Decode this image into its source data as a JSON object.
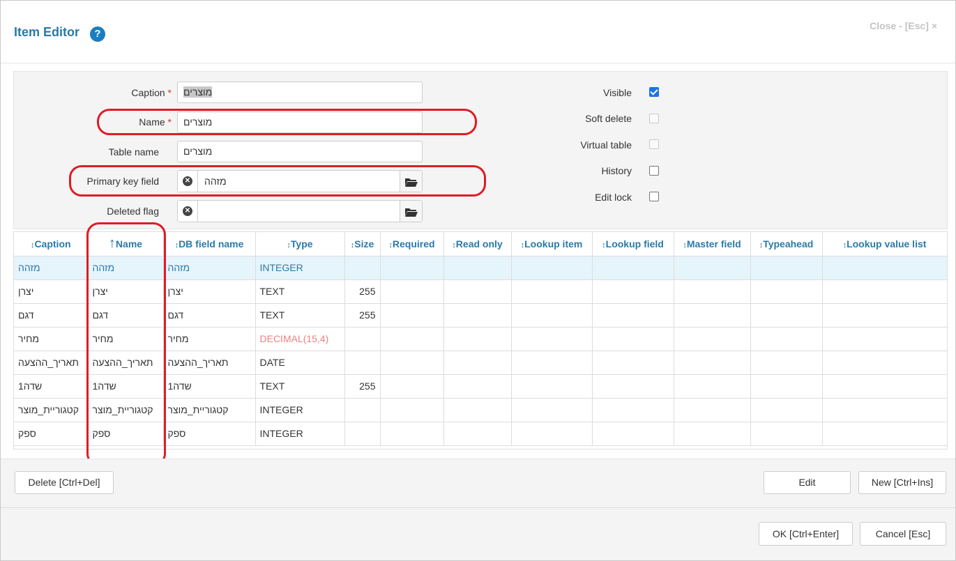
{
  "header": {
    "title": "Item Editor",
    "help_label": "?",
    "close_label": "Close - [Esc] ×"
  },
  "form": {
    "caption_label": "Caption",
    "caption_value": "מוצרים",
    "name_label": "Name",
    "name_value": "מוצרים",
    "table_name_label": "Table name",
    "table_name_value": "מוצרים",
    "primary_key_label": "Primary key field",
    "primary_key_value": "מזהה",
    "deleted_flag_label": "Deleted flag",
    "deleted_flag_value": "",
    "required_mark": "*",
    "visible_label": "Visible",
    "visible_checked": true,
    "soft_delete_label": "Soft delete",
    "soft_delete_checked": false,
    "virtual_table_label": "Virtual table",
    "virtual_table_checked": false,
    "history_label": "History",
    "history_checked": false,
    "edit_lock_label": "Edit lock",
    "edit_lock_checked": false
  },
  "table": {
    "columns": [
      "Caption",
      "Name",
      "DB field name",
      "Type",
      "Size",
      "Required",
      "Read only",
      "Lookup item",
      "Lookup field",
      "Master field",
      "Typeahead",
      "Lookup value list"
    ],
    "sort_icon": "↕",
    "active_sort_icon": "↑",
    "rows": [
      {
        "caption": "מזהה",
        "name": "מזהה",
        "db": "מזהה",
        "type": "INTEGER",
        "size": ""
      },
      {
        "caption": "יצרן",
        "name": "יצרן",
        "db": "יצרן",
        "type": "TEXT",
        "size": "255"
      },
      {
        "caption": "דגם",
        "name": "דגם",
        "db": "דגם",
        "type": "TEXT",
        "size": "255"
      },
      {
        "caption": "מחיר",
        "name": "מחיר",
        "db": "מחיר",
        "type": "DECIMAL(15,4)",
        "size": ""
      },
      {
        "caption": "תאריך_ההצעה",
        "name": "תאריך_ההצעה",
        "db": "תאריך_ההצעה",
        "type": "DATE",
        "size": ""
      },
      {
        "caption": "שדה1",
        "name": "שדה1",
        "db": "שדה1",
        "type": "TEXT",
        "size": "255"
      },
      {
        "caption": "קטגוריית_מוצר",
        "name": "קטגוריית_מוצר",
        "db": "קטגוריית_מוצר",
        "type": "INTEGER",
        "size": ""
      },
      {
        "caption": "ספק",
        "name": "ספק",
        "db": "ספק",
        "type": "INTEGER",
        "size": ""
      }
    ]
  },
  "buttons": {
    "delete": "Delete [Ctrl+Del]",
    "edit": "Edit",
    "new": "New [Ctrl+Ins]",
    "ok": "OK [Ctrl+Enter]",
    "cancel": "Cancel [Esc]"
  }
}
